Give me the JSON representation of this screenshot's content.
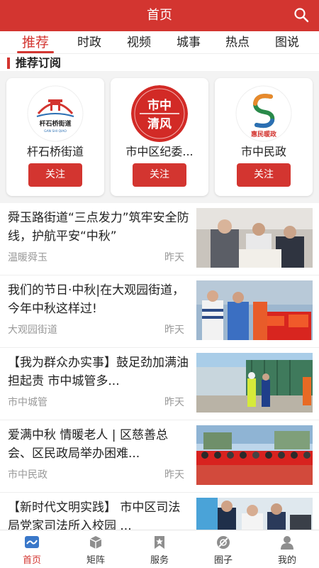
{
  "header": {
    "title": "首页",
    "search_icon": "search-icon"
  },
  "tabs": [
    "推荐",
    "时政",
    "视频",
    "城事",
    "热点",
    "图说"
  ],
  "active_tab": "推荐",
  "section": {
    "title": "推荐订阅"
  },
  "subscriptions": [
    {
      "name": "杆石桥街道",
      "follow_label": "关注",
      "logo_text": "杆石桥街道",
      "logo_subtext": "GAN SHI QIAO"
    },
    {
      "name": "市中区纪委...",
      "follow_label": "关注",
      "logo_text_1": "市中",
      "logo_text_2": "清风"
    },
    {
      "name": "市中民政",
      "follow_label": "关注",
      "logo_text": "惠民暖政"
    }
  ],
  "news": [
    {
      "headline": "舜玉路街道“三点发力”筑牢安全防线，护航平安“中秋”",
      "source": "温暖舜玉",
      "time": "昨天"
    },
    {
      "headline": "我们的节日·中秋|在大观园街道，今年中秋这样过!",
      "source": "大观园街道",
      "time": "昨天"
    },
    {
      "headline": "【我为群众办实事】鼓足劲加满油 担起责 市中城管多...",
      "source": "市中城管",
      "time": "昨天"
    },
    {
      "headline": "爱满中秋 情暖老人 | 区慈善总会、区民政局举办困难...",
      "source": "市中民政",
      "time": "昨天"
    },
    {
      "headline": "【新时代文明实践】 市中区司法局党家司法所入校园 ...",
      "source": "",
      "time": ""
    }
  ],
  "bottom_nav": [
    {
      "label": "首页",
      "icon": "home-icon"
    },
    {
      "label": "矩阵",
      "icon": "matrix-cube-icon"
    },
    {
      "label": "服务",
      "icon": "service-bookmark-icon"
    },
    {
      "label": "圈子",
      "icon": "circle-icon"
    },
    {
      "label": "我的",
      "icon": "user-icon"
    }
  ],
  "colors": {
    "brand_red": "#d33530",
    "muted_text": "#999999",
    "background_gray": "#f3f3f3"
  }
}
